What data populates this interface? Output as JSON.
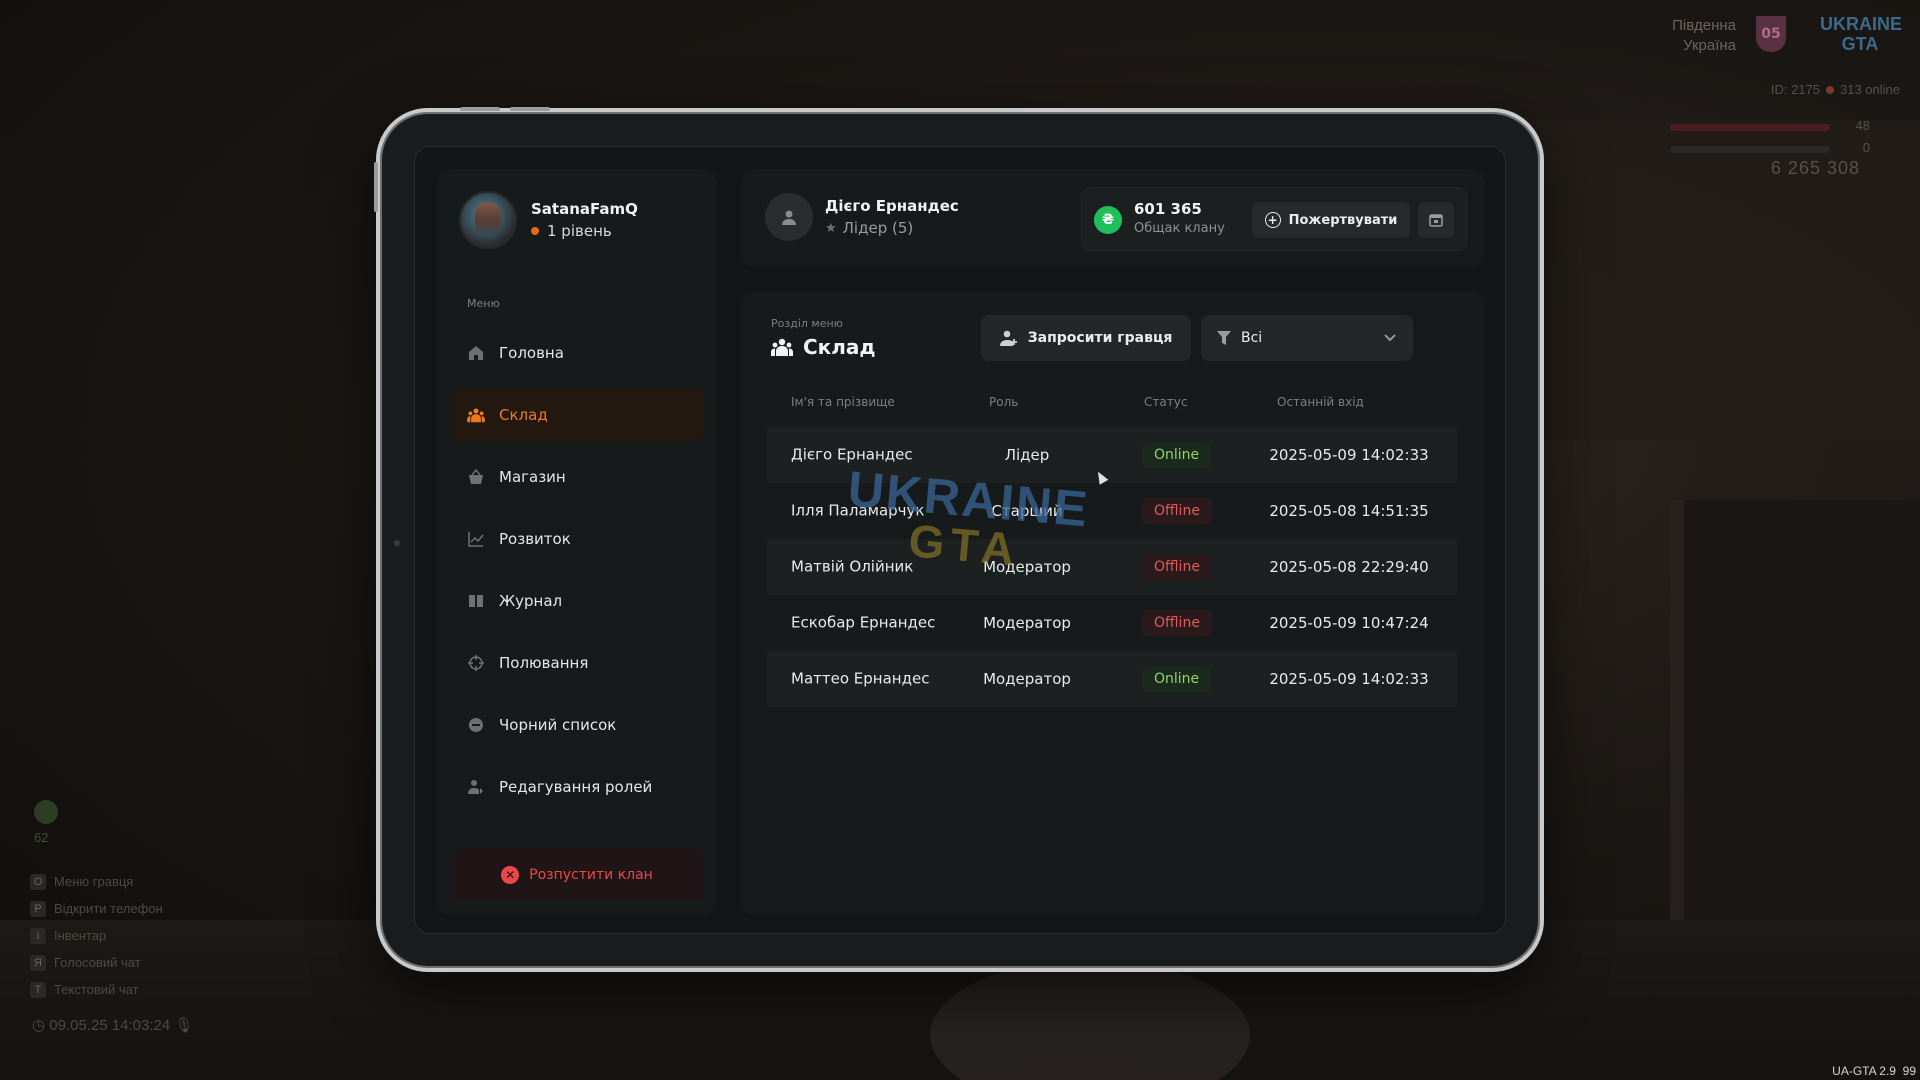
{
  "hud": {
    "region_line1": "Південна",
    "region_line2": "Україна",
    "region_badge": "05",
    "logo": "UKRAINE GTA",
    "server_id": "ID: 2175",
    "online": "313 online",
    "health": "48",
    "armor": "0",
    "money": "6 265 308",
    "ping": "62",
    "clock": "09.05.25 14:03:24",
    "version": "UA-GTA 2.9",
    "fps": "99",
    "hints": [
      {
        "key": "O",
        "label": "Меню гравця"
      },
      {
        "key": "P",
        "label": "Відкрити телефон"
      },
      {
        "key": "I",
        "label": "Інвентар"
      },
      {
        "key": "Я",
        "label": "Голосовий чат"
      },
      {
        "key": "T",
        "label": "Текстовий чат"
      }
    ]
  },
  "profile": {
    "name": "SatanaFamQ",
    "level": "1 рівень",
    "level_dot_color": "#e56a1a"
  },
  "sidebar": {
    "caption": "Меню",
    "items": [
      {
        "label": "Головна",
        "icon": "home-icon",
        "active": false
      },
      {
        "label": "Склад",
        "icon": "members-icon",
        "active": true
      },
      {
        "label": "Магазин",
        "icon": "basket-icon",
        "active": false
      },
      {
        "label": "Розвиток",
        "icon": "chart-icon",
        "active": false
      },
      {
        "label": "Журнал",
        "icon": "book-icon",
        "active": false
      },
      {
        "label": "Полювання",
        "icon": "crosshair-icon",
        "active": false
      },
      {
        "label": "Чорний список",
        "icon": "block-icon",
        "active": false
      },
      {
        "label": "Редагування ролей",
        "icon": "user-edit-icon",
        "active": false
      }
    ],
    "disband_label": "Розпустити клан"
  },
  "topbar": {
    "leader_name": "Дієго Ернандес",
    "leader_role": "Лідер (5)",
    "bank_amount": "601 365",
    "bank_label": "Общак клану",
    "donate_label": "Пожертвувати",
    "bank_icon_symbol": "₴",
    "bank_color": "#1fbf5a"
  },
  "main": {
    "caption": "Розділ меню",
    "title": "Склад",
    "invite_label": "Запросити гравця",
    "filter_value": "Всі",
    "columns": [
      "Ім'я та прізвище",
      "Роль",
      "Статус",
      "Останній вхід"
    ],
    "rows": [
      {
        "name": "Дієго Ернандес",
        "role": "Лідер",
        "status": "Online",
        "last": "2025-05-09 14:02:33"
      },
      {
        "name": "Ілля Паламарчук",
        "role": "Старший",
        "status": "Offline",
        "last": "2025-05-08 14:51:35"
      },
      {
        "name": "Матвій Олійник",
        "role": "Модератор",
        "status": "Offline",
        "last": "2025-05-08 22:29:40"
      },
      {
        "name": "Ескобар Ернандес",
        "role": "Модератор",
        "status": "Offline",
        "last": "2025-05-09 10:47:24"
      },
      {
        "name": "Маттео Ернандес",
        "role": "Модератор",
        "status": "Online",
        "last": "2025-05-09 14:02:33"
      }
    ],
    "online_color": "#8fd36a",
    "offline_color": "#e05a55",
    "accent_color": "#ee7a22"
  },
  "watermark": {
    "top": "UKRAINE",
    "bottom": "GTA"
  }
}
